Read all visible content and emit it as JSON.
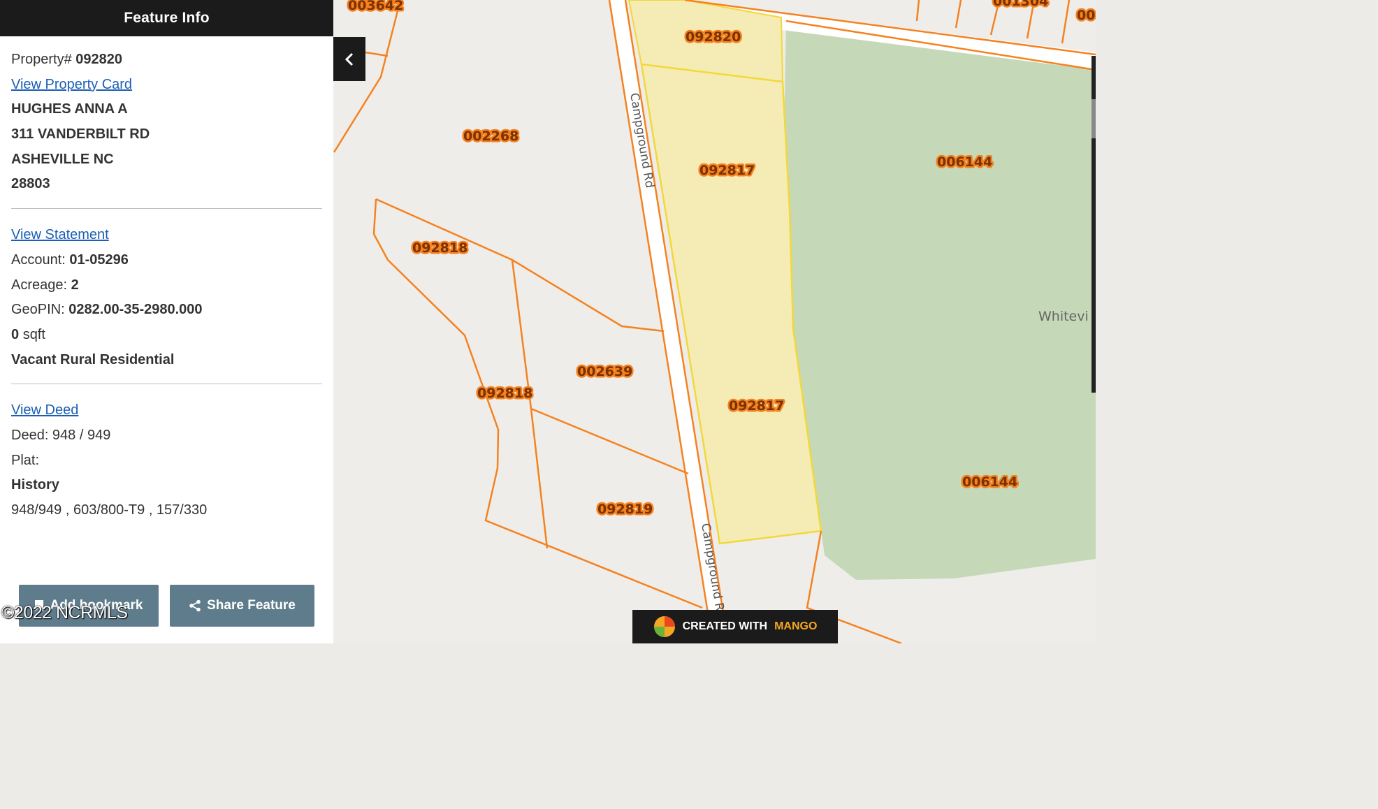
{
  "panel": {
    "title": "Feature Info",
    "property_label": "Property#",
    "property_number": "092820",
    "view_property_card": "View Property Card",
    "owner_name": "HUGHES ANNA A",
    "owner_address": "311 VANDERBILT RD",
    "owner_city": "ASHEVILLE NC",
    "owner_zip": "28803",
    "view_statement": "View Statement",
    "account_label": "Account:",
    "account_value": "01-05296",
    "acreage_label": "Acreage:",
    "acreage_value": "2",
    "geopin_label": "GeoPIN:",
    "geopin_value": "0282.00-35-2980.000",
    "sqft_value": "0",
    "sqft_label": "sqft",
    "land_use": "Vacant Rural Residential",
    "view_deed": "View Deed",
    "deed_text": "Deed: 948 / 949",
    "plat_text": "Plat:",
    "history_label": "History",
    "history_value": "948/949 , 603/800-T9 , 157/330",
    "add_bookmark": "Add bookmark",
    "share_feature": "Share Feature"
  },
  "watermark": "©2022 NCRMLS",
  "map": {
    "parcels": [
      "003642",
      "001304",
      "00",
      "092820",
      "002268",
      "092817",
      "006144",
      "092818",
      "092818",
      "002639",
      "092817",
      "006144",
      "092819"
    ],
    "road_name": "Campground Rd",
    "road_name_2": "Campground R",
    "place_name": "Whitevi",
    "colors": {
      "parcel_line": "#f58220",
      "selected_fill": "#f5ebb4",
      "selected_line": "#f3d83a",
      "green_area": "#c5d9b8"
    }
  },
  "badge": {
    "prefix": "CREATED WITH",
    "brand": "MANGO"
  },
  "icons": {
    "toggle": "chevron-left-icon",
    "bookmark": "bookmark-icon",
    "share": "share-icon",
    "logo": "mango-logo-icon"
  }
}
